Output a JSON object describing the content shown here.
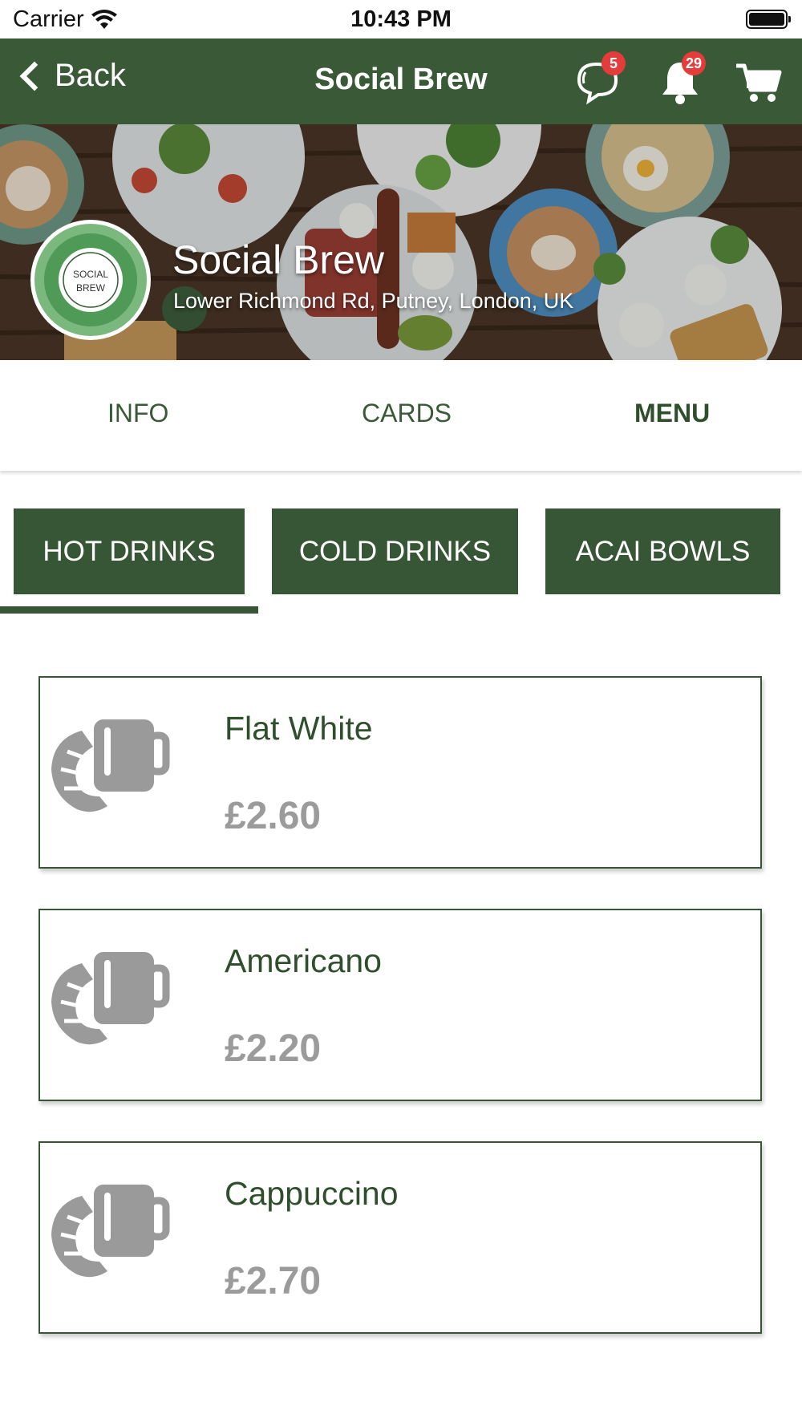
{
  "status_bar": {
    "carrier": "Carrier",
    "time": "10:43 PM"
  },
  "nav": {
    "back_label": "Back",
    "title": "Social Brew",
    "chat_badge": "5",
    "notification_badge": "29"
  },
  "venue": {
    "name": "Social Brew",
    "address": "Lower Richmond Rd, Putney, London, UK",
    "logo_text_line1": "SOCIAL",
    "logo_text_line2": "BREW"
  },
  "tabs": [
    {
      "label": "INFO",
      "active": false
    },
    {
      "label": "CARDS",
      "active": false
    },
    {
      "label": "MENU",
      "active": true
    }
  ],
  "categories": [
    {
      "label": "HOT DRINKS",
      "selected": true
    },
    {
      "label": "COLD DRINKS",
      "selected": false
    },
    {
      "label": "ACAI BOWLS",
      "selected": false
    }
  ],
  "menu_items": [
    {
      "name": "Flat White",
      "price": "£2.60",
      "icon": "coffee-croissant-icon"
    },
    {
      "name": "Americano",
      "price": "£2.20",
      "icon": "coffee-croissant-icon"
    },
    {
      "name": "Cappuccino",
      "price": "£2.70",
      "icon": "coffee-croissant-icon"
    }
  ],
  "colors": {
    "brand_green": "#3a5a37",
    "badge_red": "#e43b3b",
    "price_gray": "#9b9b9b"
  }
}
